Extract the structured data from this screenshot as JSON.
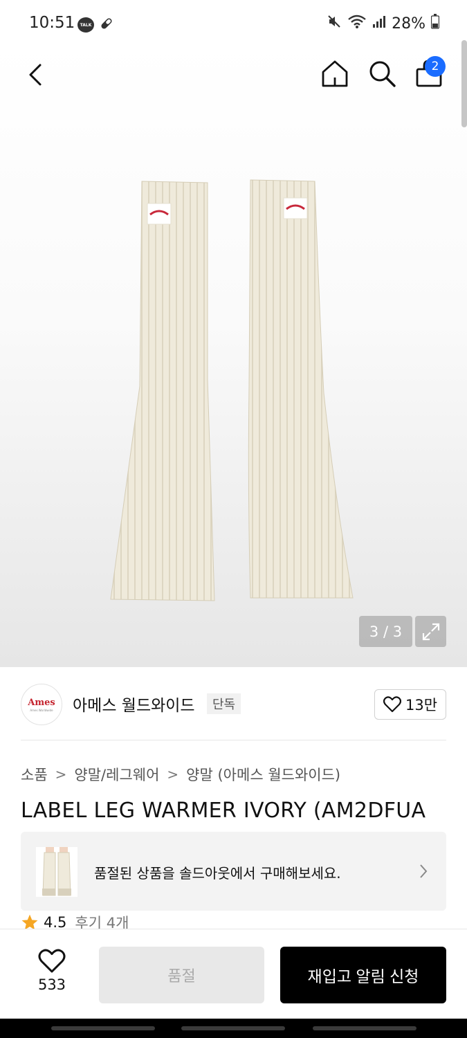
{
  "status_bar": {
    "time": "10:51",
    "talk_label": "TALK",
    "battery": "28%",
    "icons": [
      "talk-icon",
      "pill-icon",
      "mute-icon",
      "wifi-icon",
      "signal-icon",
      "battery-icon"
    ]
  },
  "header": {
    "cart_count": "2",
    "icons": [
      "back-arrow-icon",
      "home-icon",
      "search-icon",
      "shopping-bag-icon"
    ]
  },
  "gallery": {
    "counter": "3 / 3"
  },
  "brand": {
    "logo_text": "Ames",
    "logo_subtext": "Ames Worldwide",
    "name": "아메스 월드와이드",
    "badge": "단독",
    "likes": "13만"
  },
  "breadcrumb": [
    "소품",
    "양말/레그웨어",
    "양말 (아메스 월드와이드)"
  ],
  "product": {
    "title": "LABEL LEG WARMER IVORY (AM2DFUA"
  },
  "soldout_banner": {
    "text": "품절된 상품을 솔드아웃에서 구매해보세요."
  },
  "rating": {
    "value": "4.5",
    "reviews": "후기 4개"
  },
  "bottom_bar": {
    "wish_count": "533",
    "soldout_label": "품절",
    "restock_label": "재입고 알림 신청"
  },
  "colors": {
    "accent_badge": "#1a6cff",
    "primary_button": "#000000",
    "rating_star": "#f5a623",
    "brand_logo": "#c4232e"
  }
}
